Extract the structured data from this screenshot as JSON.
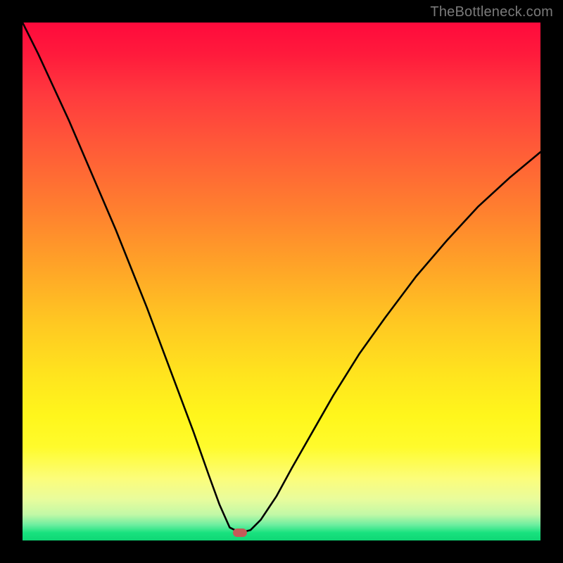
{
  "watermark": {
    "text": "TheBottleneck.com"
  },
  "chart_data": {
    "type": "line",
    "title": "",
    "xlabel": "",
    "ylabel": "",
    "xlim": [
      0,
      100
    ],
    "ylim": [
      0,
      100
    ],
    "grid": false,
    "annotations": [
      {
        "name": "min-marker",
        "x": 42,
        "y": 1.5,
        "color": "#c45a58"
      }
    ],
    "background_gradient": {
      "direction": "vertical",
      "stops": [
        {
          "pos": 0,
          "color": "#ff0a3c"
        },
        {
          "pos": 0.24,
          "color": "#ff5a38"
        },
        {
          "pos": 0.5,
          "color": "#ffb425"
        },
        {
          "pos": 0.75,
          "color": "#fff31d"
        },
        {
          "pos": 0.92,
          "color": "#e9fc9c"
        },
        {
          "pos": 1.0,
          "color": "#0fd675"
        }
      ]
    },
    "series": [
      {
        "name": "bottleneck-curve",
        "color": "#000000",
        "x": [
          0,
          3,
          6,
          9,
          12,
          15,
          18,
          21,
          24,
          27,
          30,
          33,
          36,
          38,
          40,
          42,
          44,
          46,
          49,
          52,
          56,
          60,
          65,
          70,
          76,
          82,
          88,
          94,
          100
        ],
        "y": [
          100,
          94,
          87.5,
          81,
          74,
          67,
          60,
          52.5,
          45,
          37,
          29,
          21,
          12.5,
          7,
          2.5,
          1.5,
          2,
          4,
          8.5,
          14,
          21,
          28,
          36,
          43,
          51,
          58,
          64.5,
          70,
          75
        ]
      }
    ],
    "legend": null
  }
}
